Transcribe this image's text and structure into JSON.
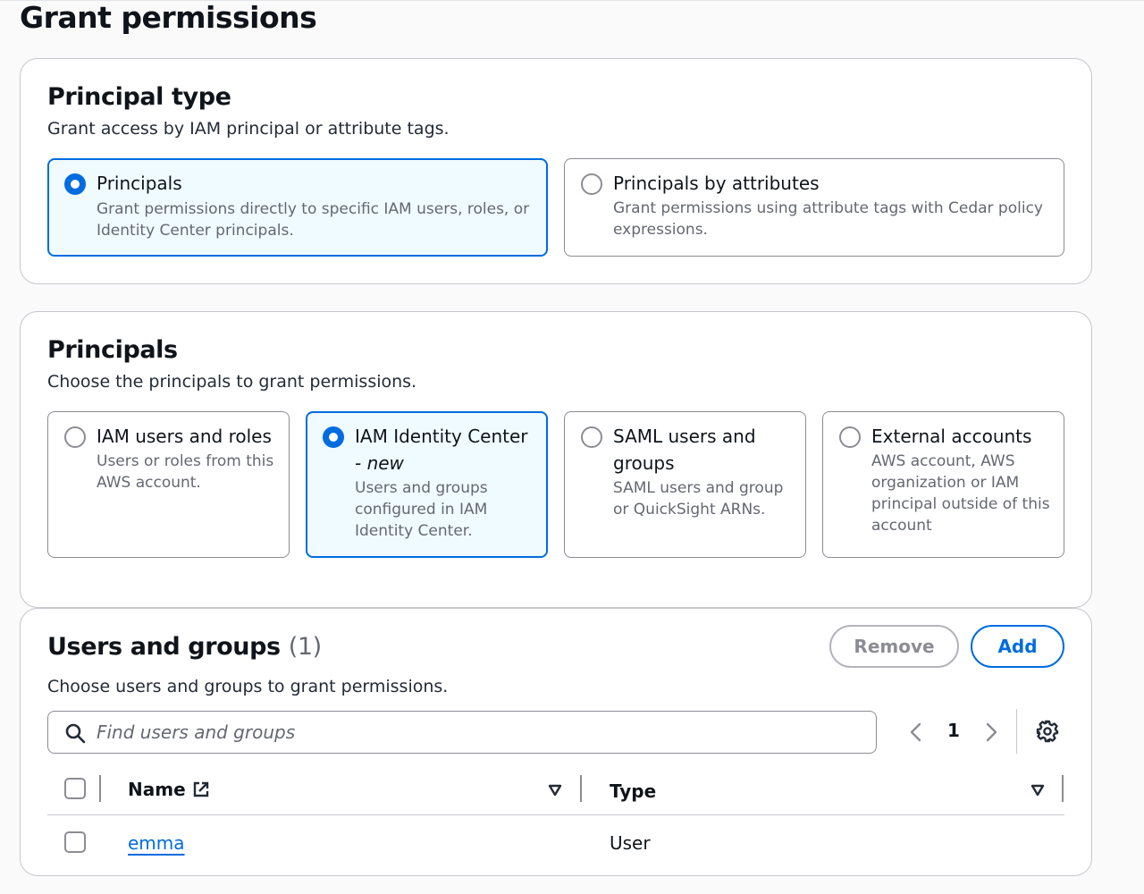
{
  "page": {
    "title": "Grant permissions"
  },
  "principal_type": {
    "title": "Principal type",
    "description": "Grant access by IAM principal or attribute tags.",
    "options": [
      {
        "label": "Principals",
        "description": "Grant permissions directly to specific IAM users, roles, or Identity Center principals.",
        "selected": true
      },
      {
        "label": "Principals by attributes",
        "description": "Grant permissions using attribute tags with Cedar policy expressions.",
        "selected": false
      }
    ]
  },
  "principals": {
    "title": "Principals",
    "description": "Choose the principals to grant permissions.",
    "options": [
      {
        "label": "IAM users and roles",
        "description": "Users or roles from this AWS account.",
        "selected": false
      },
      {
        "label": "IAM Identity Center",
        "badge": "- new",
        "description": "Users and groups configured in IAM Identity Center.",
        "selected": true
      },
      {
        "label": "SAML users and groups",
        "description": "SAML users and group or QuickSight ARNs.",
        "selected": false
      },
      {
        "label": "External accounts",
        "description": "AWS account, AWS organization or IAM principal outside of this account",
        "selected": false
      }
    ]
  },
  "users_groups": {
    "title": "Users and groups",
    "count": "(1)",
    "description": "Choose users and groups to grant permissions.",
    "remove_label": "Remove",
    "add_label": "Add",
    "search": {
      "placeholder": "Find users and groups",
      "value": ""
    },
    "pagination": {
      "current_page": "1"
    },
    "columns": [
      "Name",
      "Type"
    ],
    "rows": [
      {
        "name": "emma",
        "type": "User"
      }
    ]
  },
  "colors": {
    "accent": "#006ce0",
    "selected_bg": "#f0fbff",
    "border": "#8c8c94",
    "muted_text": "#656871"
  },
  "icons": [
    "search-icon",
    "chevron-left-icon",
    "chevron-right-icon",
    "gear-icon",
    "external-link-icon",
    "sort-down-icon"
  ]
}
